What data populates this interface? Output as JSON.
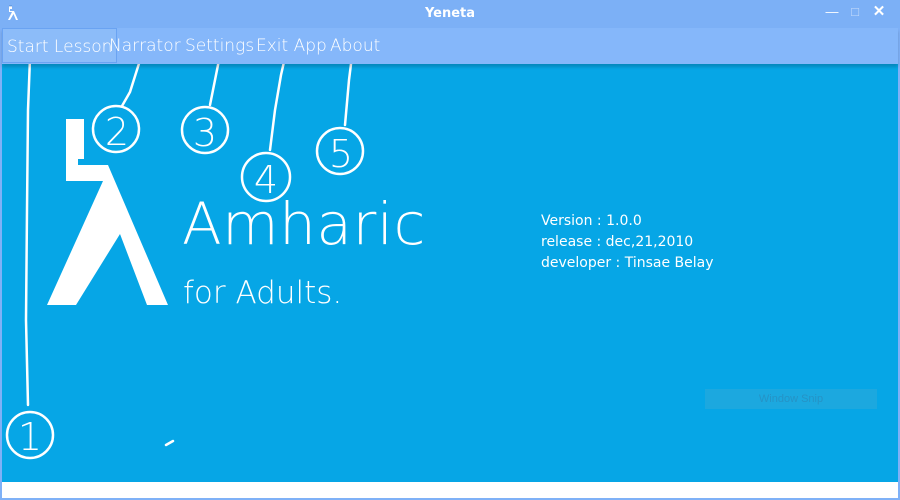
{
  "window": {
    "title": "Yeneta",
    "icon": "amharic-letter-icon",
    "minimize": "—",
    "maximize": "□",
    "close": "✕"
  },
  "menu": {
    "items": [
      {
        "label": "Start Lesson",
        "selected": true
      },
      {
        "label": "Narrator",
        "selected": false
      },
      {
        "label": "Settings",
        "selected": false
      },
      {
        "label": "Exit App",
        "selected": false
      },
      {
        "label": "About",
        "selected": false
      }
    ]
  },
  "hero": {
    "glyph": "ኢ",
    "title": "Amharic",
    "subtitle": "for Adults."
  },
  "info": {
    "version": "Version : 1.0.0",
    "release": "release : dec,21,2010",
    "developer": "developer : Tinsae Belay"
  },
  "overlay": {
    "snip_label": "Window Snip"
  },
  "annotations": [
    "1",
    "2",
    "3",
    "4",
    "5"
  ],
  "colors": {
    "content_bg": "#06a6e6",
    "titlebar_bg": "#7cb0f6",
    "menubar_bg": "#85b7fa",
    "text": "#ffffff"
  }
}
